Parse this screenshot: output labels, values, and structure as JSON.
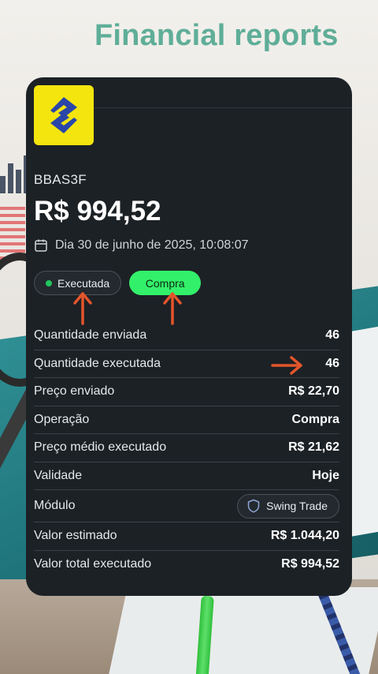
{
  "background": {
    "title": "Financial reports"
  },
  "card": {
    "ticker": "BBAS3F",
    "price": "R$ 994,52",
    "date": "Dia 30 de junho de 2025, 10:08:07",
    "status_chip": "Executada",
    "side_chip": "Compra",
    "rows": [
      {
        "label": "Quantidade enviada",
        "value": "46"
      },
      {
        "label": "Quantidade executada",
        "value": "46"
      },
      {
        "label": "Preço enviado",
        "value": "R$ 22,70"
      },
      {
        "label": "Operação",
        "value": "Compra"
      },
      {
        "label": "Preço médio executado",
        "value": "R$ 21,62"
      },
      {
        "label": "Validade",
        "value": "Hoje"
      },
      {
        "label": "Módulo",
        "value": "Swing Trade"
      },
      {
        "label": "Valor estimado",
        "value": "R$ 1.044,20"
      },
      {
        "label": "Valor total executado",
        "value": "R$ 994,52"
      }
    ],
    "icons": {
      "logo": "banco-do-brasil-logo",
      "date": "calendar-icon",
      "module": "shield-icon"
    }
  },
  "colors": {
    "card_bg": "#1c2125",
    "logo_yellow": "#f4e50f",
    "buy_chip": "#33f06a",
    "status_dot": "#22c55e",
    "arrow": "#e4552b"
  }
}
